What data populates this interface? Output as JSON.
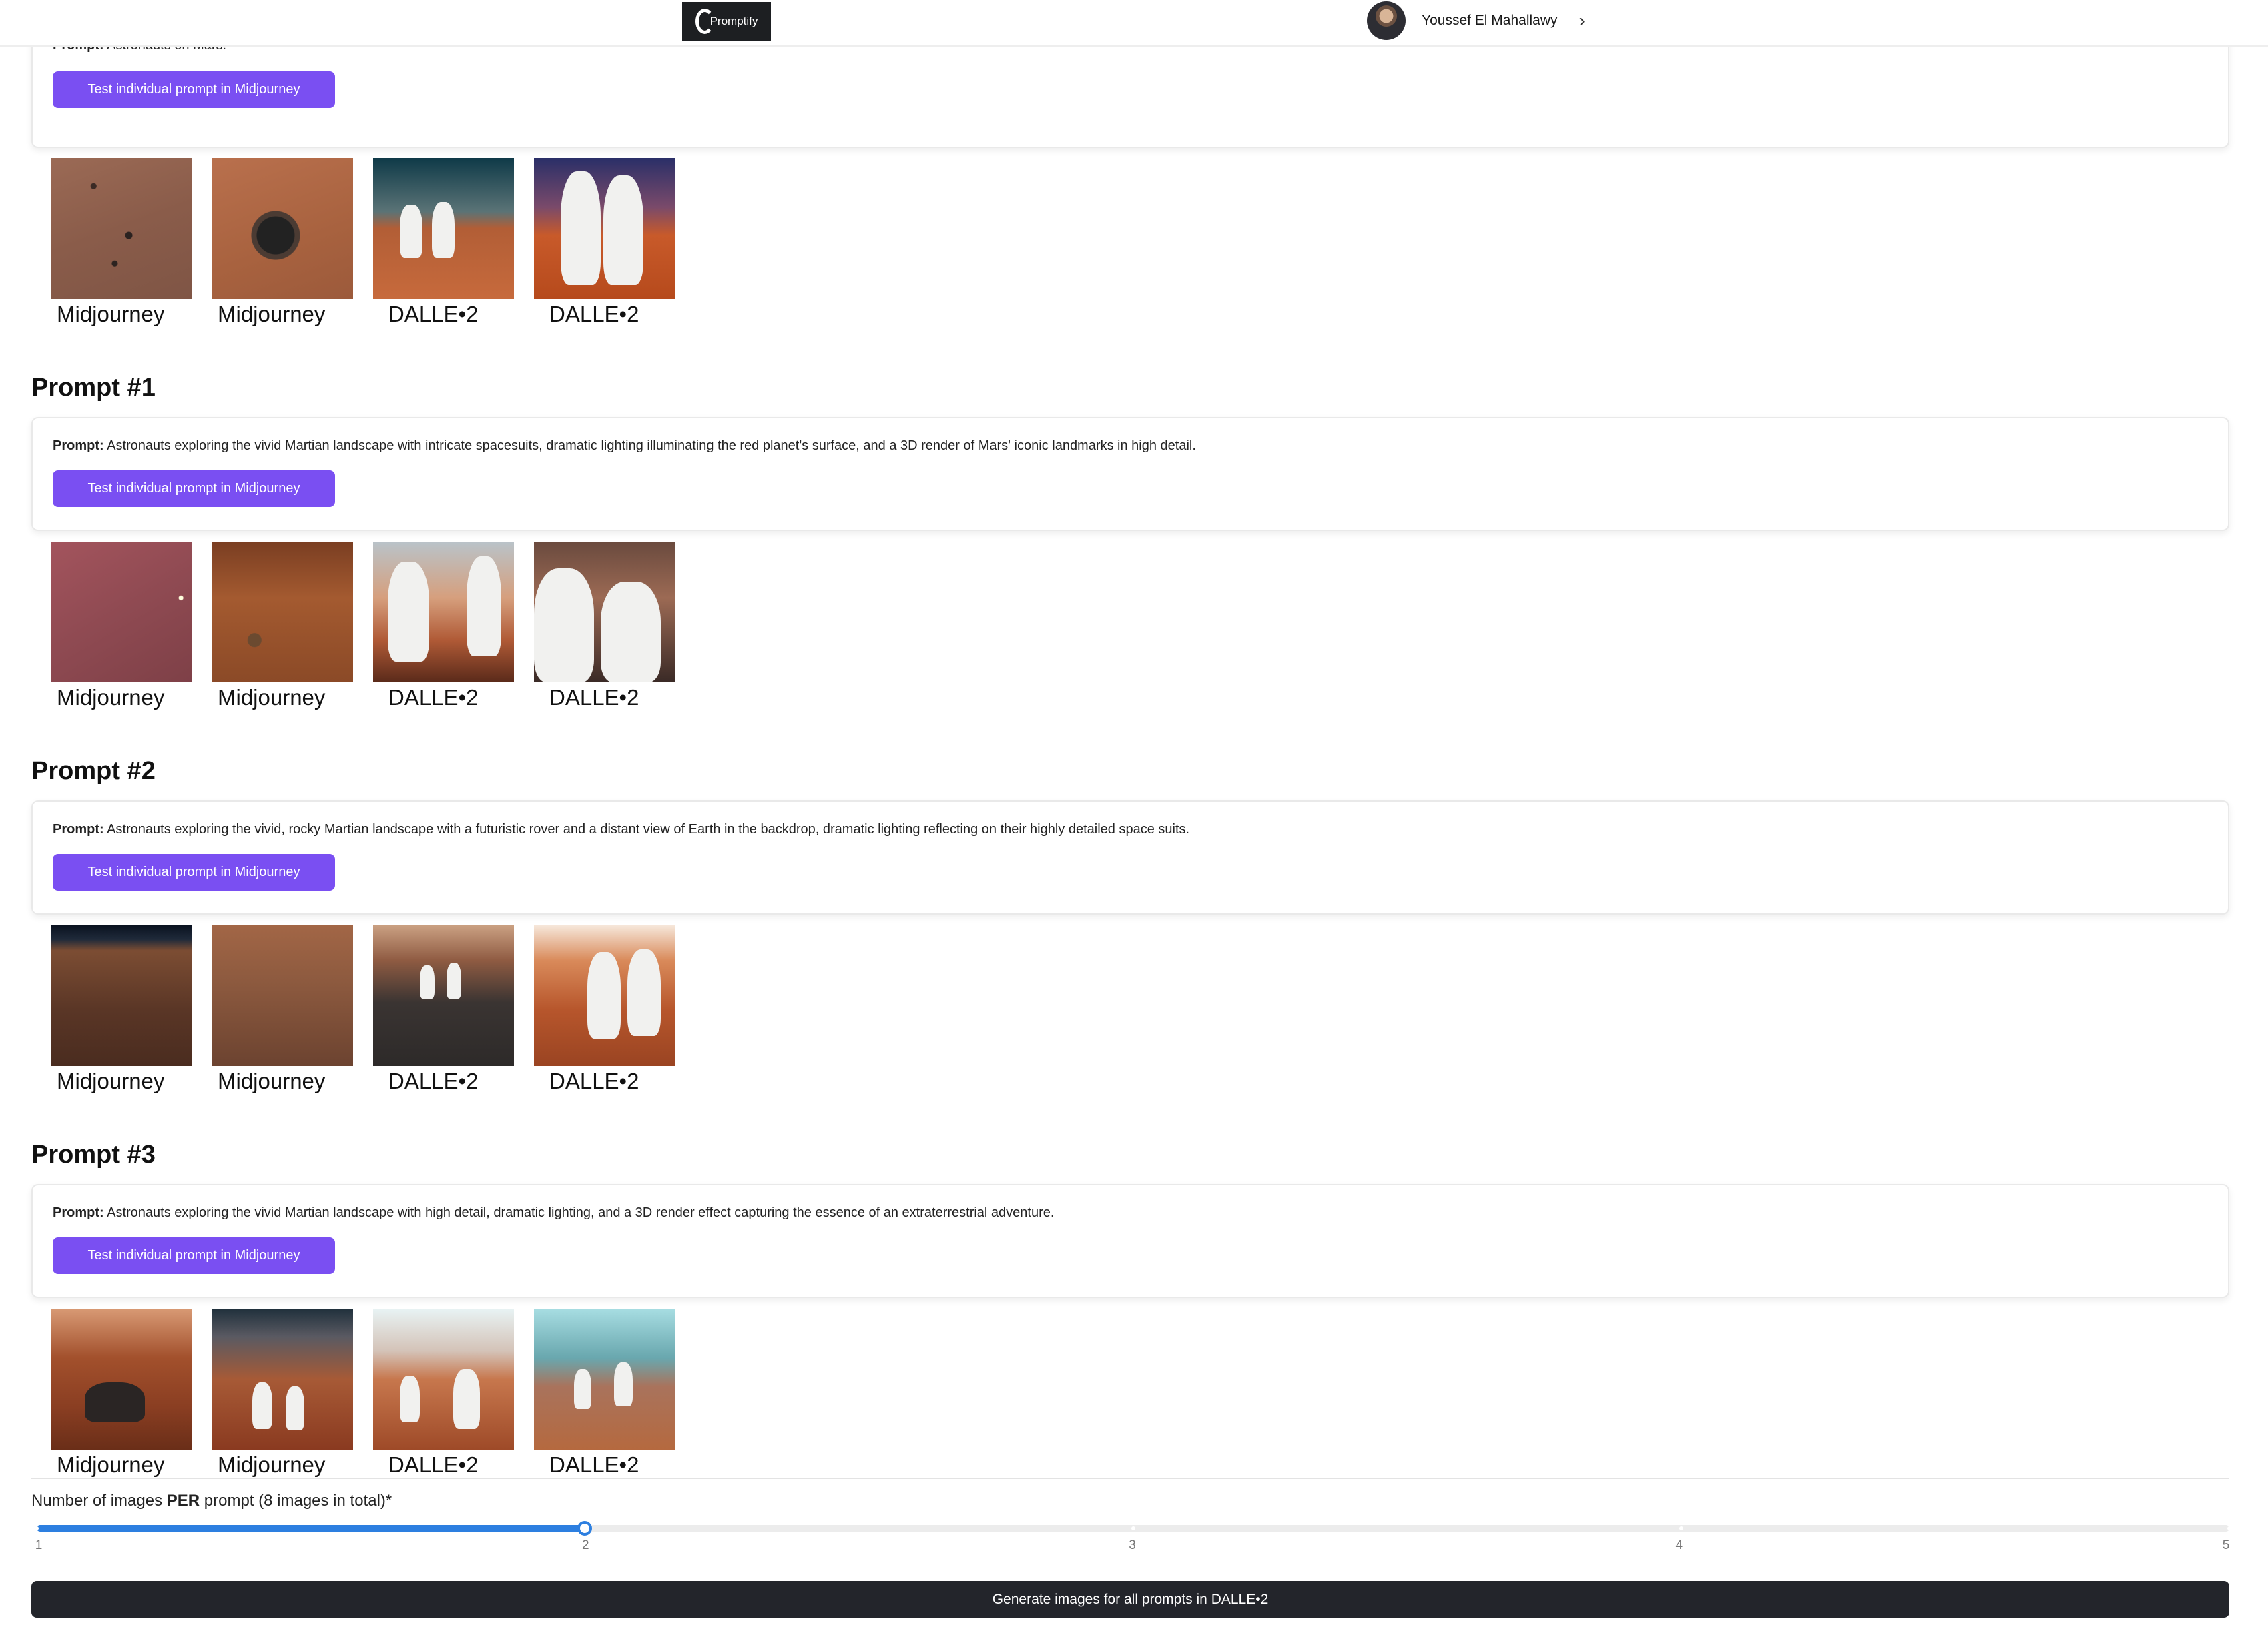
{
  "header": {
    "logo_text": "Promptify",
    "user_name": "Youssef El Mahallawy",
    "chevron": "›"
  },
  "prompt_label": "Prompt:",
  "test_button_label": "Test individual prompt in Midjourney",
  "sections": [
    {
      "heading": "",
      "prompt": "Astronauts on Mars.",
      "captions": [
        "Midjourney",
        "Midjourney",
        "DALLE•2",
        "DALLE•2"
      ]
    },
    {
      "heading": "Prompt #1",
      "prompt": "Astronauts exploring the vivid Martian landscape with intricate spacesuits, dramatic lighting illuminating the red planet's surface, and a 3D render of Mars' iconic landmarks in high detail.",
      "captions": [
        "Midjourney",
        "Midjourney",
        "DALLE•2",
        "DALLE•2"
      ]
    },
    {
      "heading": "Prompt #2",
      "prompt": "Astronauts exploring the vivid, rocky Martian landscape with a futuristic rover and a distant view of Earth in the backdrop, dramatic lighting reflecting on their highly detailed space suits.",
      "captions": [
        "Midjourney",
        "Midjourney",
        "DALLE•2",
        "DALLE•2"
      ]
    },
    {
      "heading": "Prompt #3",
      "prompt": "Astronauts exploring the vivid Martian landscape with high detail, dramatic lighting, and a 3D render effect capturing the essence of an extraterrestrial adventure.",
      "captions": [
        "Midjourney",
        "Midjourney",
        "DALLE•2",
        "DALLE•2"
      ]
    }
  ],
  "slider": {
    "label_pre": "Number of images ",
    "label_bold": "PER",
    "label_post": " prompt (8 images in total)*",
    "ticks": [
      "1",
      "2",
      "3",
      "4",
      "5"
    ],
    "min": 1,
    "max": 5,
    "value": 2,
    "accent_color": "#2d7fe0"
  },
  "generate_button_label": "Generate images for all prompts in DALLE•2",
  "colors": {
    "button_purple": "#7a4ff2",
    "button_dark": "#23252b"
  }
}
